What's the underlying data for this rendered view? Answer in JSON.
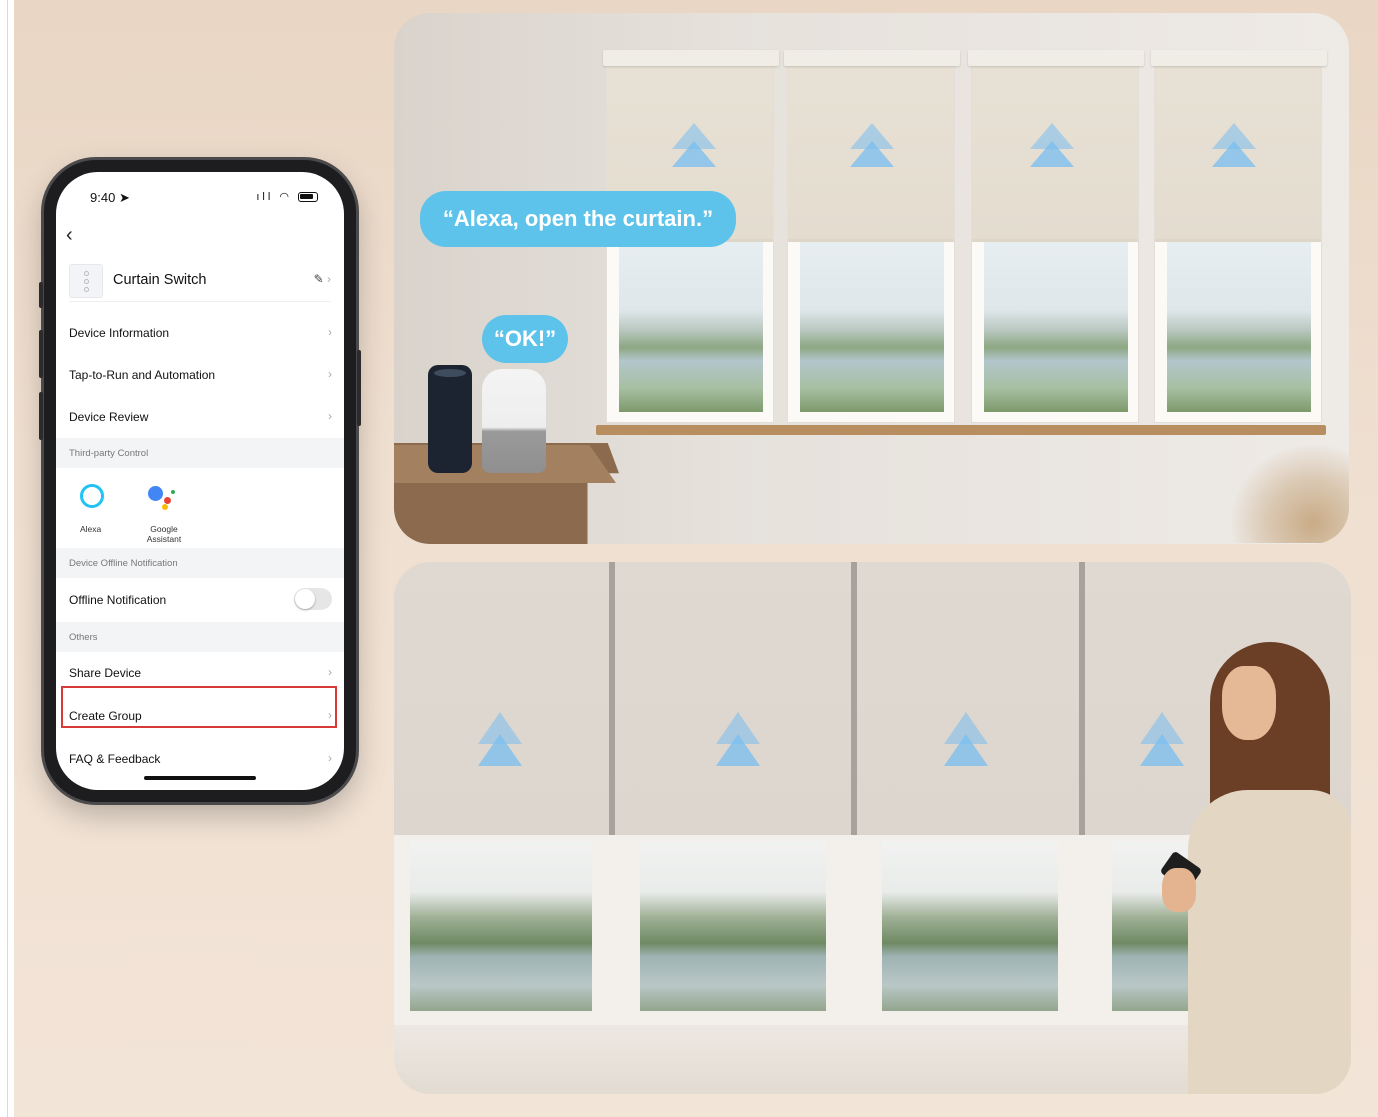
{
  "phone": {
    "status": {
      "time": "9:40",
      "signal": "ıll",
      "wifi": "◠"
    },
    "device_name": "Curtain Switch",
    "menu": [
      {
        "label": "Device Information"
      },
      {
        "label": "Tap-to-Run and Automation"
      },
      {
        "label": "Device Review"
      }
    ],
    "section_third_party": "Third-party Control",
    "third_party": [
      {
        "label": "Alexa"
      },
      {
        "label": "Google Assistant"
      }
    ],
    "section_offline": "Device Offline Notification",
    "offline_label": "Offline Notification",
    "offline_enabled": false,
    "section_others": "Others",
    "others": [
      {
        "label": "Share Device"
      },
      {
        "label": "Create Group",
        "highlighted": true
      },
      {
        "label": "FAQ & Feedback"
      }
    ]
  },
  "scene_top": {
    "speech_main": "“Alexa, open the curtain.”",
    "speech_reply": "“OK!”"
  },
  "colors": {
    "bubble": "#5ec3ea",
    "arrow": "#8fcaf0",
    "highlight": "#d83a3a"
  }
}
